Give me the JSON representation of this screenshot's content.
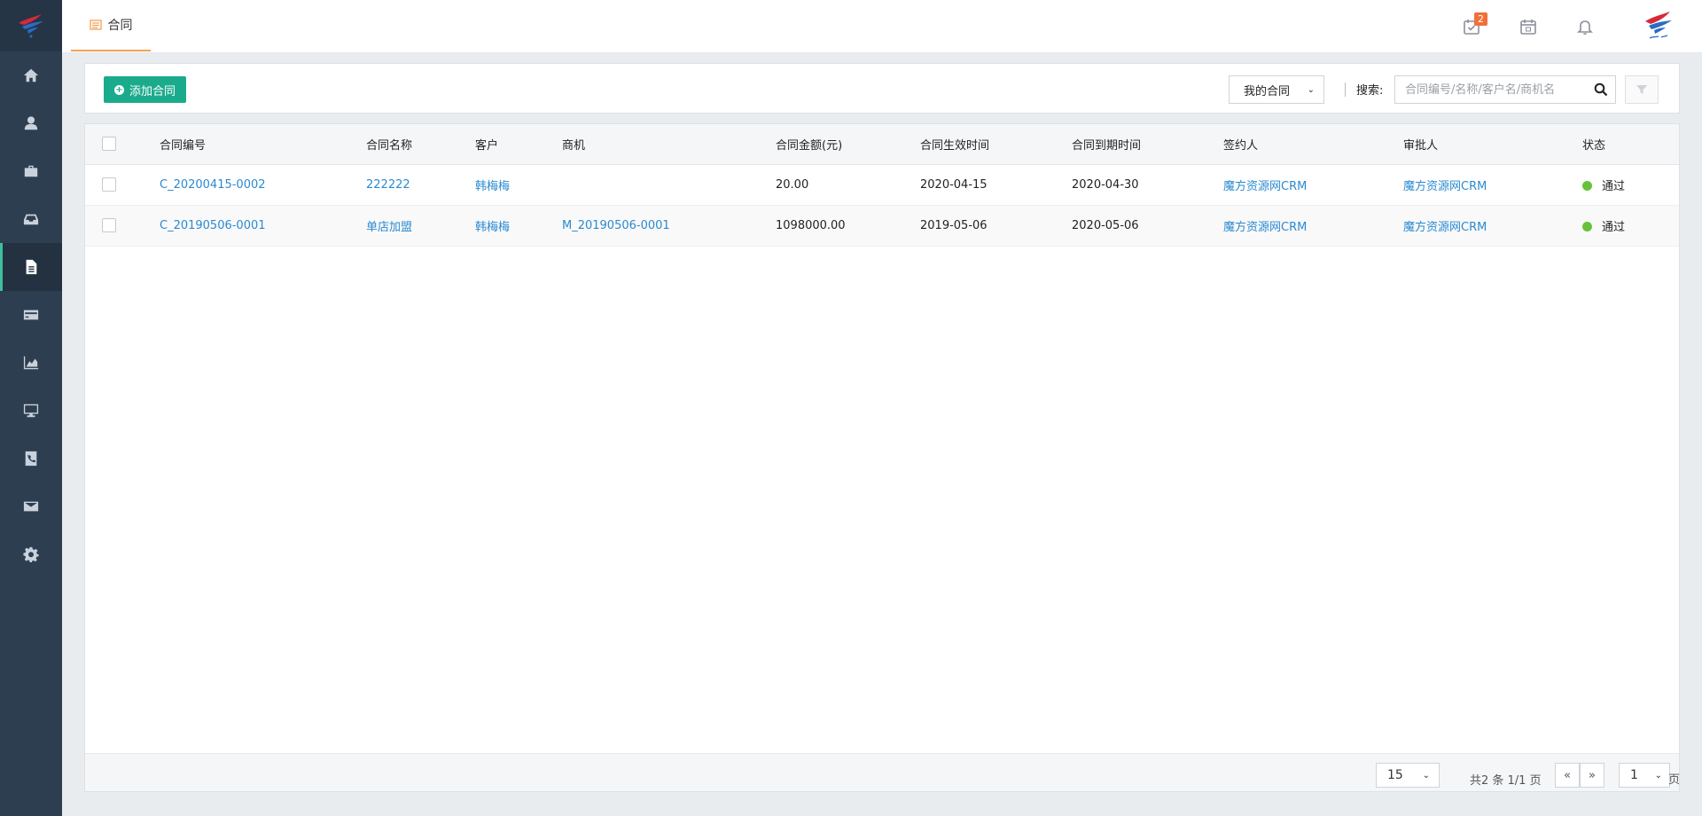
{
  "sidebar": {
    "items": [
      {
        "icon": "home-icon",
        "name": "nav-home"
      },
      {
        "icon": "user-icon",
        "name": "nav-customers"
      },
      {
        "icon": "briefcase-icon",
        "name": "nav-opportunities"
      },
      {
        "icon": "inbox-icon",
        "name": "nav-inbox"
      },
      {
        "icon": "document-icon",
        "name": "nav-contracts",
        "active": true
      },
      {
        "icon": "credit-card-icon",
        "name": "nav-payments"
      },
      {
        "icon": "area-chart-icon",
        "name": "nav-reports"
      },
      {
        "icon": "monitor-icon",
        "name": "nav-dashboard"
      },
      {
        "icon": "phone-book-icon",
        "name": "nav-contacts"
      },
      {
        "icon": "envelope-icon",
        "name": "nav-mail"
      },
      {
        "icon": "gear-icon",
        "name": "nav-settings"
      }
    ]
  },
  "header": {
    "tab_label": "合同",
    "task_badge": "2"
  },
  "toolbar": {
    "add_label": "添加合同",
    "scope_value": "我的合同",
    "search_label": "搜索:",
    "search_placeholder": "合同编号/名称/客户名/商机名"
  },
  "table": {
    "headers": {
      "no": "合同编号",
      "name": "合同名称",
      "customer": "客户",
      "opportunity": "商机",
      "amount": "合同金额(元)",
      "start": "合同生效时间",
      "end": "合同到期时间",
      "signer": "签约人",
      "approver": "审批人",
      "status": "状态"
    },
    "rows": [
      {
        "no": "C_20200415-0002",
        "name": "222222",
        "customer": "韩梅梅",
        "opportunity": "",
        "amount": "20.00",
        "start": "2020-04-15",
        "end": "2020-04-30",
        "signer": "魔方资源网CRM",
        "approver": "魔方资源网CRM",
        "status": "通过"
      },
      {
        "no": "C_20190506-0001",
        "name": "单店加盟",
        "customer": "韩梅梅",
        "opportunity": "M_20190506-0001",
        "amount": "1098000.00",
        "start": "2019-05-06",
        "end": "2020-05-06",
        "signer": "魔方资源网CRM",
        "approver": "魔方资源网CRM",
        "status": "通过"
      }
    ]
  },
  "pager": {
    "page_size": "15",
    "info": "共2 条 1/1 页",
    "prev": "«",
    "next": "»",
    "current": "1",
    "unit": "页"
  },
  "colors": {
    "sidebar_bg": "#2d3e50",
    "accent_green": "#1aab8c",
    "link_blue": "#2a8ad1",
    "tab_underline": "#f5a053",
    "badge": "#f0703a",
    "status_ok": "#67c23a"
  }
}
